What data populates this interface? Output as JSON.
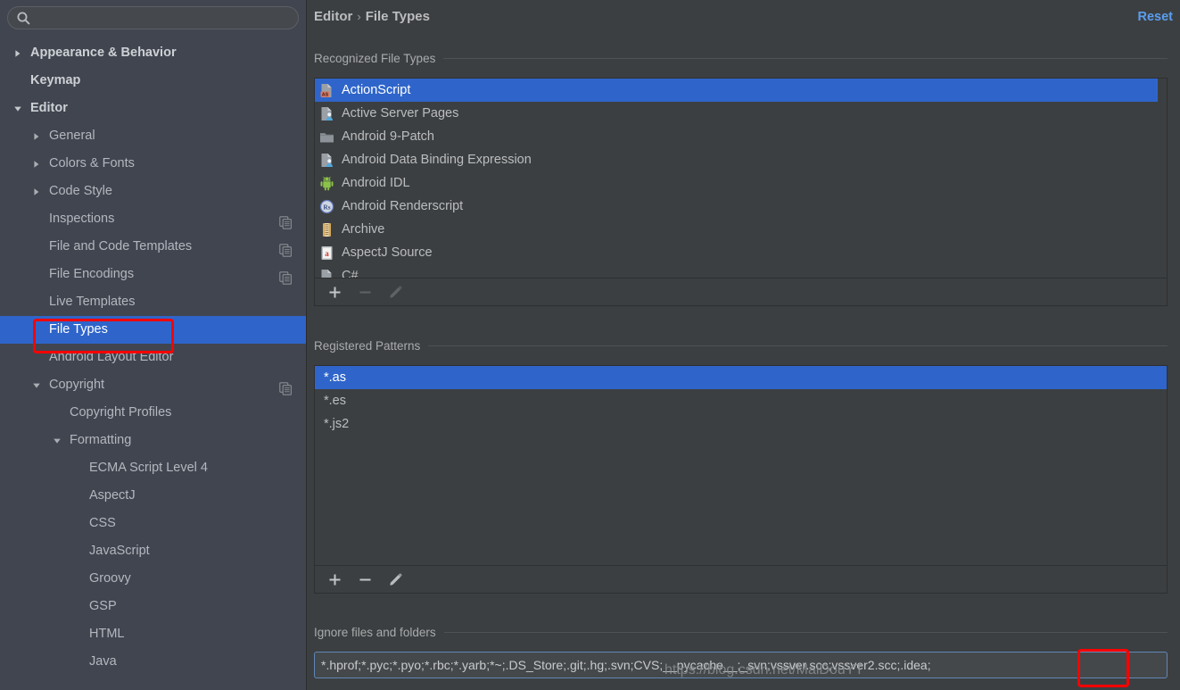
{
  "sidebar": {
    "search": {
      "value": "",
      "placeholder": ""
    },
    "items": [
      {
        "label": "Appearance & Behavior",
        "indent": 0,
        "arrow": "right",
        "bold": true,
        "copy": false,
        "selected": false
      },
      {
        "label": "Keymap",
        "indent": 0,
        "arrow": "none",
        "bold": true,
        "copy": false,
        "selected": false
      },
      {
        "label": "Editor",
        "indent": 0,
        "arrow": "down",
        "bold": true,
        "copy": false,
        "selected": false
      },
      {
        "label": "General",
        "indent": 1,
        "arrow": "right",
        "bold": false,
        "copy": false,
        "selected": false
      },
      {
        "label": "Colors & Fonts",
        "indent": 1,
        "arrow": "right",
        "bold": false,
        "copy": false,
        "selected": false
      },
      {
        "label": "Code Style",
        "indent": 1,
        "arrow": "right",
        "bold": false,
        "copy": false,
        "selected": false
      },
      {
        "label": "Inspections",
        "indent": 1,
        "arrow": "none",
        "bold": false,
        "copy": true,
        "selected": false
      },
      {
        "label": "File and Code Templates",
        "indent": 1,
        "arrow": "none",
        "bold": false,
        "copy": true,
        "selected": false
      },
      {
        "label": "File Encodings",
        "indent": 1,
        "arrow": "none",
        "bold": false,
        "copy": true,
        "selected": false
      },
      {
        "label": "Live Templates",
        "indent": 1,
        "arrow": "none",
        "bold": false,
        "copy": false,
        "selected": false
      },
      {
        "label": "File Types",
        "indent": 1,
        "arrow": "none",
        "bold": false,
        "copy": false,
        "selected": true
      },
      {
        "label": "Android Layout Editor",
        "indent": 1,
        "arrow": "none",
        "bold": false,
        "copy": false,
        "selected": false
      },
      {
        "label": "Copyright",
        "indent": 1,
        "arrow": "down",
        "bold": false,
        "copy": true,
        "selected": false
      },
      {
        "label": "Copyright Profiles",
        "indent": 2,
        "arrow": "none",
        "bold": false,
        "copy": false,
        "selected": false
      },
      {
        "label": "Formatting",
        "indent": 2,
        "arrow": "down",
        "bold": false,
        "copy": false,
        "selected": false
      },
      {
        "label": "ECMA Script Level 4",
        "indent": 3,
        "arrow": "none",
        "bold": false,
        "copy": false,
        "selected": false
      },
      {
        "label": "AspectJ",
        "indent": 3,
        "arrow": "none",
        "bold": false,
        "copy": false,
        "selected": false
      },
      {
        "label": "CSS",
        "indent": 3,
        "arrow": "none",
        "bold": false,
        "copy": false,
        "selected": false
      },
      {
        "label": "JavaScript",
        "indent": 3,
        "arrow": "none",
        "bold": false,
        "copy": false,
        "selected": false
      },
      {
        "label": "Groovy",
        "indent": 3,
        "arrow": "none",
        "bold": false,
        "copy": false,
        "selected": false
      },
      {
        "label": "GSP",
        "indent": 3,
        "arrow": "none",
        "bold": false,
        "copy": false,
        "selected": false
      },
      {
        "label": "HTML",
        "indent": 3,
        "arrow": "none",
        "bold": false,
        "copy": false,
        "selected": false
      },
      {
        "label": "Java",
        "indent": 3,
        "arrow": "none",
        "bold": false,
        "copy": false,
        "selected": false
      }
    ]
  },
  "header": {
    "breadcrumb_parent": "Editor",
    "breadcrumb_sep": "›",
    "breadcrumb_current": "File Types",
    "reset_label": "Reset"
  },
  "recognized": {
    "title": "Recognized File Types",
    "items": [
      {
        "label": "ActionScript",
        "icon": "as-file-icon",
        "selected": true
      },
      {
        "label": "Active Server Pages",
        "icon": "asp-file-icon",
        "selected": false
      },
      {
        "label": "Android 9-Patch",
        "icon": "folder-icon",
        "selected": false
      },
      {
        "label": "Android Data Binding Expression",
        "icon": "asp-file-icon",
        "selected": false
      },
      {
        "label": "Android IDL",
        "icon": "android-robot-icon",
        "selected": false
      },
      {
        "label": "Android Renderscript",
        "icon": "renderscript-icon",
        "selected": false
      },
      {
        "label": "Archive",
        "icon": "archive-zip-icon",
        "selected": false
      },
      {
        "label": "AspectJ Source",
        "icon": "aspectj-file-icon",
        "selected": false
      },
      {
        "label": "C#",
        "icon": "csharp-file-icon",
        "selected": false
      }
    ],
    "toolbar": [
      {
        "name": "add-file-type-button",
        "glyph": "+",
        "enabled": true
      },
      {
        "name": "remove-file-type-button",
        "glyph": "−",
        "enabled": false
      },
      {
        "name": "edit-file-type-button",
        "glyph": "pencil",
        "enabled": false
      }
    ]
  },
  "patterns": {
    "title": "Registered Patterns",
    "items": [
      {
        "label": "*.as",
        "selected": true
      },
      {
        "label": "*.es",
        "selected": false
      },
      {
        "label": "*.js2",
        "selected": false
      }
    ],
    "toolbar": [
      {
        "name": "add-pattern-button",
        "glyph": "+",
        "enabled": true
      },
      {
        "name": "remove-pattern-button",
        "glyph": "−",
        "enabled": true
      },
      {
        "name": "edit-pattern-button",
        "glyph": "pencil",
        "enabled": true
      }
    ]
  },
  "ignore": {
    "title": "Ignore files and folders",
    "value": "*.hprof;*.pyc;*.pyo;*.rbc;*.yarb;*~;.DS_Store;.git;.hg;.svn;CVS;__pycache__;_svn;vssver.scc;vssver2.scc;.idea;"
  },
  "watermark": "https://blog.csdn.net/MaiDouYT",
  "colors": {
    "selection_blue": "#2f65ca",
    "link_blue": "#5a9ef0",
    "sidebar_bg": "#414550",
    "panel_bg": "#3c3f41",
    "annotation_red": "#ff0000"
  }
}
